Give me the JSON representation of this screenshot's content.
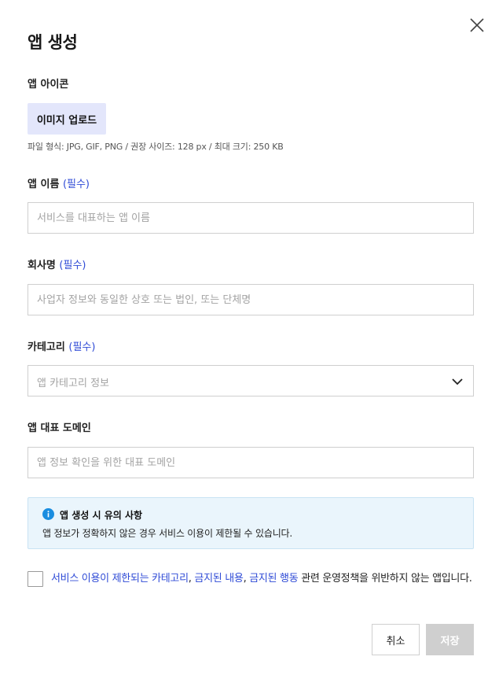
{
  "dialog": {
    "title": "앱 생성",
    "close_icon": "close-icon"
  },
  "app_icon": {
    "label": "앱 아이콘",
    "upload_label": "이미지 업로드",
    "hint": "파일 형식: JPG, GIF, PNG / 권장 사이즈: 128 px / 최대 크기: 250 KB"
  },
  "app_name": {
    "label": "앱 이름",
    "required": "(필수)",
    "value": "",
    "placeholder": "서비스를 대표하는 앱 이름"
  },
  "company": {
    "label": "회사명",
    "required": "(필수)",
    "value": "",
    "placeholder": "사업자 정보와 동일한 상호 또는 법인, 또는 단체명"
  },
  "category": {
    "label": "카테고리",
    "required": "(필수)",
    "selected": "앱 카테고리 정보",
    "chevron_icon": "chevron-down-icon"
  },
  "domain": {
    "label": "앱 대표 도메인",
    "value": "",
    "placeholder": "앱 정보 확인을 위한 대표 도메인"
  },
  "notice": {
    "icon": "info-icon",
    "title": "앱 생성 시 유의 사항",
    "body": "앱 정보가 정확하지 않은 경우 서비스 이용이 제한될 수 있습니다."
  },
  "agreement": {
    "checked": false,
    "link1": "서비스 이용이 제한되는 카테고리",
    "sep1": ", ",
    "link2": "금지된 내용",
    "sep2": ", ",
    "link3": "금지된 행동",
    "rest": " 관련 운영정책을 위반하지 않는 앱입니다."
  },
  "actions": {
    "cancel_label": "취소",
    "save_label": "저장"
  },
  "colors": {
    "accent": "#2f4bd6",
    "upload_bg": "#e3e6fb",
    "notice_bg": "#eaf5fc",
    "info_icon": "#1a8de0",
    "disabled_button": "#cfcfcf"
  }
}
